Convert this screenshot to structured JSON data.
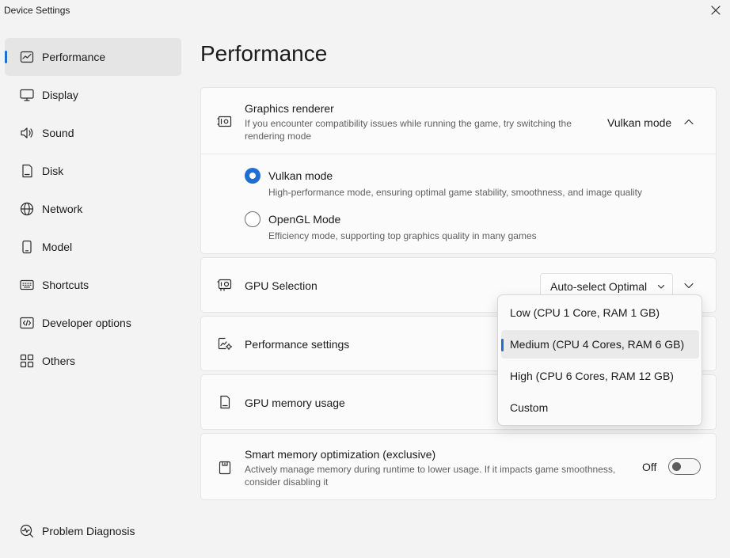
{
  "window": {
    "title": "Device Settings"
  },
  "sidebar": {
    "items": [
      {
        "label": "Performance",
        "icon": "chart-line-icon",
        "selected": true
      },
      {
        "label": "Display",
        "icon": "monitor-icon"
      },
      {
        "label": "Sound",
        "icon": "speaker-icon"
      },
      {
        "label": "Disk",
        "icon": "disk-icon"
      },
      {
        "label": "Network",
        "icon": "globe-icon"
      },
      {
        "label": "Model",
        "icon": "phone-icon"
      },
      {
        "label": "Shortcuts",
        "icon": "keyboard-icon"
      },
      {
        "label": "Developer options",
        "icon": "code-icon"
      },
      {
        "label": "Others",
        "icon": "grid-icon"
      }
    ],
    "footer": {
      "label": "Problem Diagnosis",
      "icon": "diagnosis-icon"
    }
  },
  "main": {
    "title": "Performance",
    "graphics_renderer": {
      "title": "Graphics renderer",
      "description": "If you encounter compatibility issues while running the game, try switching the rendering mode",
      "value": "Vulkan mode",
      "expanded": true,
      "options": [
        {
          "label": "Vulkan mode",
          "description": "High-performance mode, ensuring optimal game stability, smoothness, and image quality",
          "selected": true
        },
        {
          "label": "OpenGL Mode",
          "description": "Efficiency mode, supporting top graphics quality in many games",
          "selected": false
        }
      ]
    },
    "gpu_selection": {
      "title": "GPU Selection",
      "value": "Auto-select Optimal"
    },
    "performance_settings": {
      "title": "Performance settings"
    },
    "gpu_memory": {
      "title": "GPU memory usage"
    },
    "smart_memory": {
      "title": "Smart memory optimization (exclusive)",
      "description": "Actively manage memory during runtime to lower usage. If it impacts game smoothness, consider disabling it",
      "toggle_label": "Off",
      "enabled": false
    }
  },
  "performance_dropdown": {
    "options": [
      {
        "label": "Low (CPU 1 Core, RAM 1 GB)"
      },
      {
        "label": "Medium (CPU 4 Cores, RAM 6 GB)",
        "selected": true
      },
      {
        "label": "High (CPU 6 Cores, RAM 12 GB)"
      },
      {
        "label": "Custom"
      }
    ]
  },
  "colors": {
    "accent": "#1f6fd0",
    "background": "#f3f3f3",
    "card": "#fbfbfb"
  }
}
